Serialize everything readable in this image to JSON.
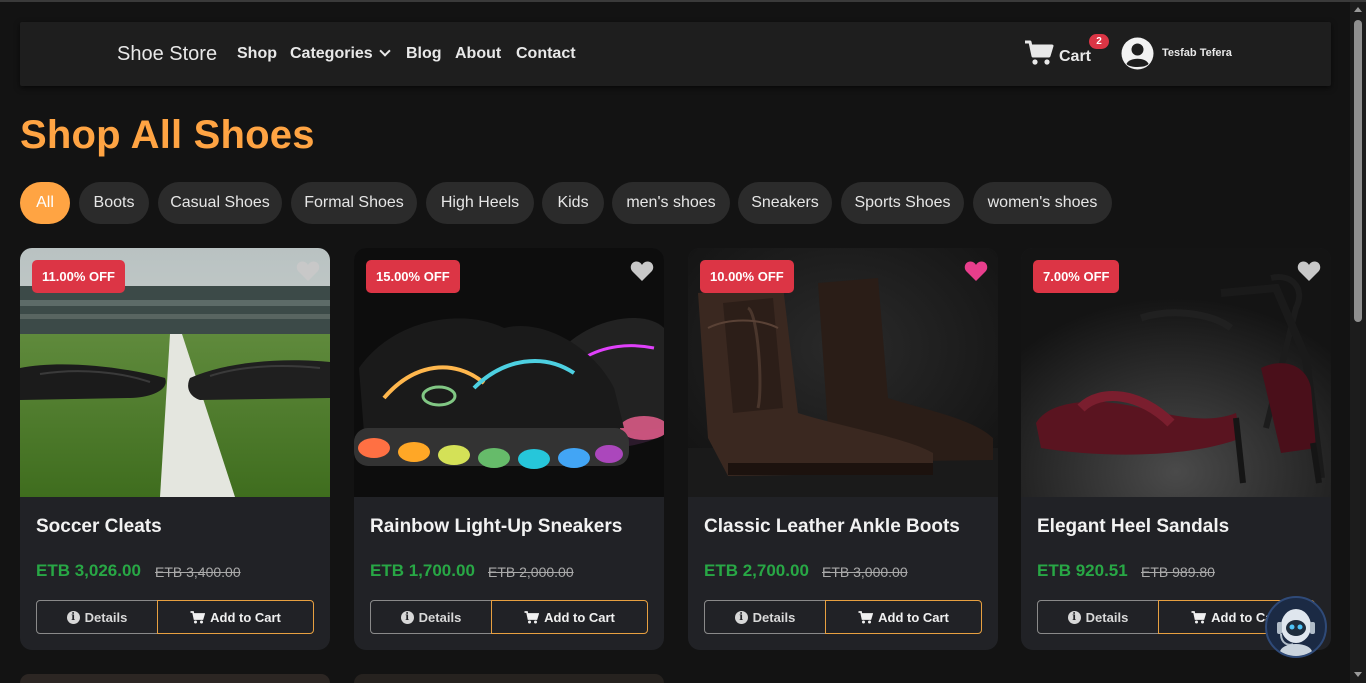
{
  "nav": {
    "brand": "Shoe Store",
    "links": [
      "Shop",
      "Categories",
      "Blog",
      "About",
      "Contact"
    ],
    "cart_label": "Cart",
    "cart_count": "2",
    "user_name": "Tesfab Tefera"
  },
  "page": {
    "title": "Shop All Shoes"
  },
  "filters": [
    "All",
    "Boots",
    "Casual Shoes",
    "Formal Shoes",
    "High Heels",
    "Kids",
    "men's shoes",
    "Sneakers",
    "Sports Shoes",
    "women's shoes"
  ],
  "products": [
    {
      "title": "Soccer Cleats",
      "discount": "11.00% OFF",
      "price": "ETB 3,026.00",
      "old_price": "ETB 3,400.00",
      "favorited": false
    },
    {
      "title": "Rainbow Light-Up Sneakers",
      "discount": "15.00% OFF",
      "price": "ETB 1,700.00",
      "old_price": "ETB 2,000.00",
      "favorited": false
    },
    {
      "title": "Classic Leather Ankle Boots",
      "discount": "10.00% OFF",
      "price": "ETB 2,700.00",
      "old_price": "ETB 3,000.00",
      "favorited": true
    },
    {
      "title": "Elegant Heel Sandals",
      "discount": "7.00% OFF",
      "price": "ETB 920.51",
      "old_price": "ETB 989.80",
      "favorited": false
    }
  ],
  "buttons": {
    "details": "Details",
    "add_to_cart": "Add to Cart"
  },
  "colors": {
    "accent": "#ffa443",
    "price": "#28a745",
    "badge": "#dc3545",
    "favorite": "#e83e8c"
  },
  "icons": {
    "cart": "cart-icon",
    "user": "user-circle-icon",
    "heart": "heart-icon",
    "info": "info-icon",
    "assistant": "robot-assistant-icon"
  }
}
